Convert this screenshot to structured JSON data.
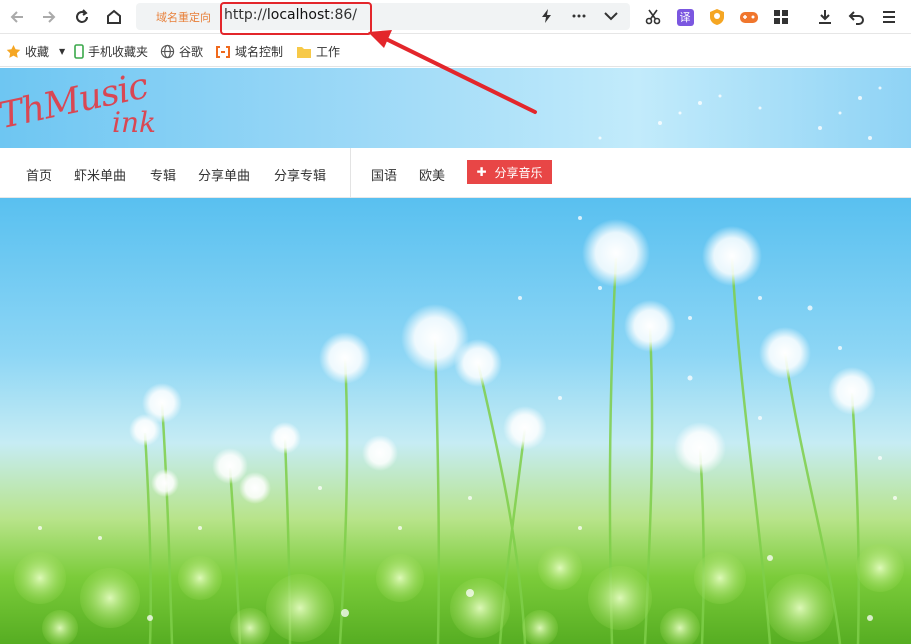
{
  "browser": {
    "address_tag": "域名重定向",
    "url_prefix": "http://",
    "url_host": "localhost",
    "url_suffix": ":86/"
  },
  "toolbar_icons": [
    "back-arrow-icon",
    "forward-arrow-icon",
    "reload-icon",
    "home-icon",
    "lightning-icon",
    "more-icon",
    "chevron-down-icon",
    "scissors-icon",
    "translate-icon",
    "shield-extension-icon",
    "game-extension-icon",
    "apps-grid-icon",
    "download-icon",
    "undo-icon",
    "menu-icon"
  ],
  "translate_glyph": "译",
  "bookmarks": [
    {
      "label": "收藏",
      "icon": "star-icon"
    },
    {
      "label": "手机收藏夹",
      "icon": "phone-icon"
    },
    {
      "label": "谷歌",
      "icon": "globe-icon"
    },
    {
      "label": "域名控制",
      "icon": "bracket-logo-icon"
    },
    {
      "label": "工作",
      "icon": "folder-icon"
    }
  ],
  "site": {
    "logo_line1": "ThMusic",
    "logo_line2": "ink",
    "nav": [
      "首页",
      "虾米单曲",
      "专辑",
      "分享单曲",
      "分享专辑"
    ],
    "nav_right": [
      "国语",
      "欧美"
    ],
    "share_button": "分享音乐"
  },
  "colors": {
    "accent_red": "#e84646",
    "annotation_red": "#e3262b",
    "logo": "#d94753"
  }
}
